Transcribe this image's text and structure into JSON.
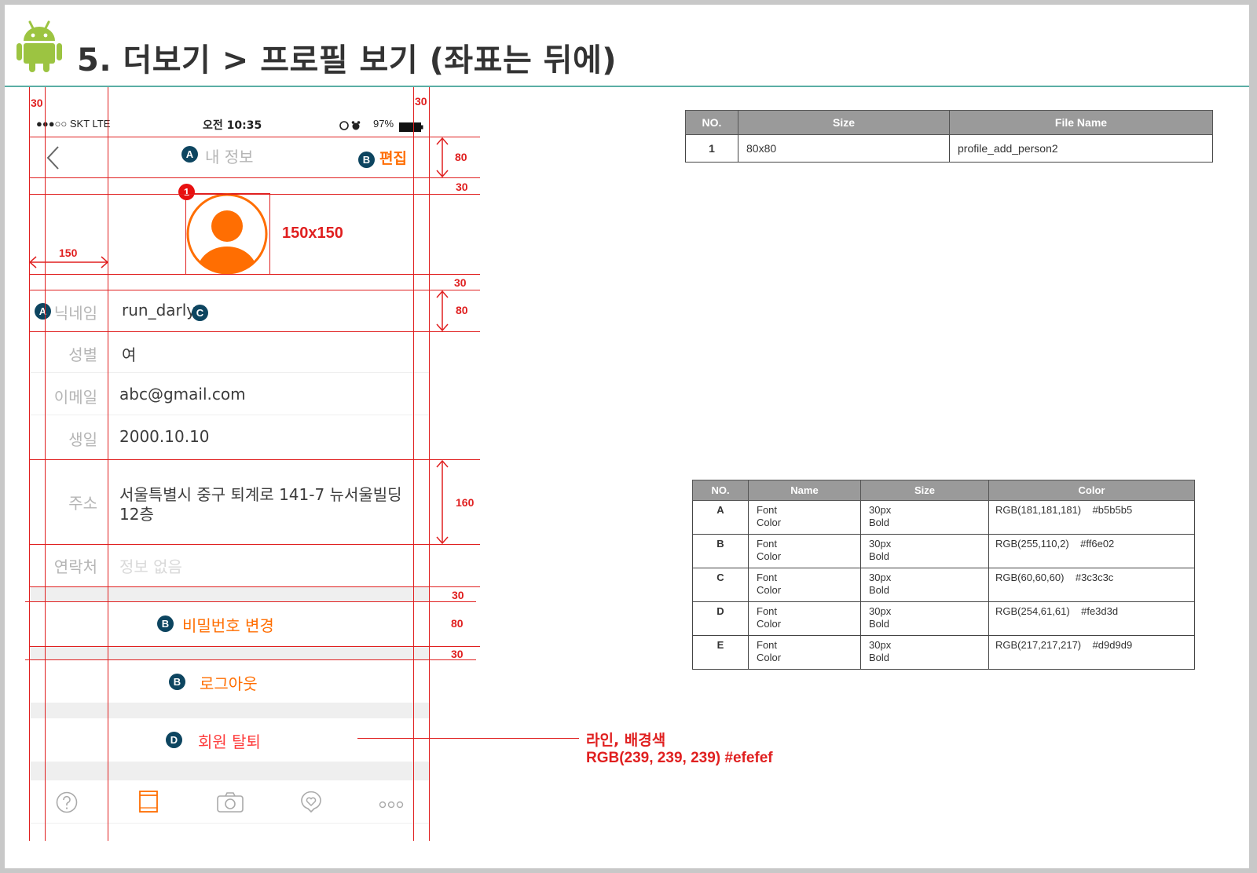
{
  "slide": {
    "title": "5. 더보기 > 프로필 보기 (좌표는 뒤에)"
  },
  "status_bar": {
    "carrier": "●●●○○ SKT   LTE",
    "time": "오전 10:35",
    "battery": "97%"
  },
  "nav": {
    "title": "내 정보",
    "edit": "편집"
  },
  "profile": {
    "size_label": "150x150"
  },
  "fields": [
    {
      "label": "닉네임",
      "value": "run_darly"
    },
    {
      "label": "성별",
      "value": "여"
    },
    {
      "label": "이메일",
      "value": "abc@gmail.com"
    },
    {
      "label": "생일",
      "value": "2000.10.10"
    },
    {
      "label": "주소",
      "value_line1": "서울특별시 중구 퇴계로 141-7 뉴서울빌딩",
      "value_line2": "12층"
    },
    {
      "label": "연락처",
      "value": "정보 없음"
    }
  ],
  "actions": {
    "change_password": "비밀번호 변경",
    "logout": "로그아웃",
    "withdraw": "회원 탈퇴"
  },
  "badges": {
    "a": "A",
    "b": "B",
    "c": "C",
    "d": "D",
    "n1": "1"
  },
  "dimensions": {
    "d30": "30",
    "d80": "80",
    "d150": "150",
    "d160": "160"
  },
  "annotation": {
    "line1": "라인, 배경색",
    "line2": "RGB(239, 239, 239) #efefef"
  },
  "image_table": {
    "headers": [
      "NO.",
      "Size",
      "File Name"
    ],
    "rows": [
      [
        "1",
        "80x80",
        "profile_add_person2"
      ]
    ]
  },
  "font_table": {
    "headers": [
      "NO.",
      "Name",
      "Size",
      "Color"
    ],
    "rows": [
      {
        "no": "A",
        "name1": "Font",
        "name2": "Color",
        "size1": "30px",
        "size2": "Bold",
        "color": "RGB(181,181,181)    #b5b5b5"
      },
      {
        "no": "B",
        "name1": "Font",
        "name2": "Color",
        "size1": "30px",
        "size2": "Bold",
        "color": "RGB(255,110,2)    #ff6e02"
      },
      {
        "no": "C",
        "name1": "Font",
        "name2": "Color",
        "size1": "30px",
        "size2": "Bold",
        "color": "RGB(60,60,60)    #3c3c3c"
      },
      {
        "no": "D",
        "name1": "Font",
        "name2": "Color",
        "size1": "30px",
        "size2": "Bold",
        "color": "RGB(254,61,61)    #fe3d3d"
      },
      {
        "no": "E",
        "name1": "Font",
        "name2": "Color",
        "size1": "30px",
        "size2": "Bold",
        "color": "RGB(217,217,217)    #d9d9d9"
      }
    ]
  },
  "colors": {
    "accent_orange": "#ff6e02",
    "guide_red": "#e02020",
    "badge_navy": "#0d4560",
    "label_grey": "#b5b5b5",
    "value_dark": "#3c3c3c",
    "line_bg": "#efefef"
  },
  "icons": {
    "android": "android-icon",
    "back": "chevron-left-icon",
    "profile": "person-icon",
    "tabs": [
      "question-icon",
      "book-icon",
      "camera-icon",
      "heart-chat-icon",
      "more-icon"
    ]
  }
}
